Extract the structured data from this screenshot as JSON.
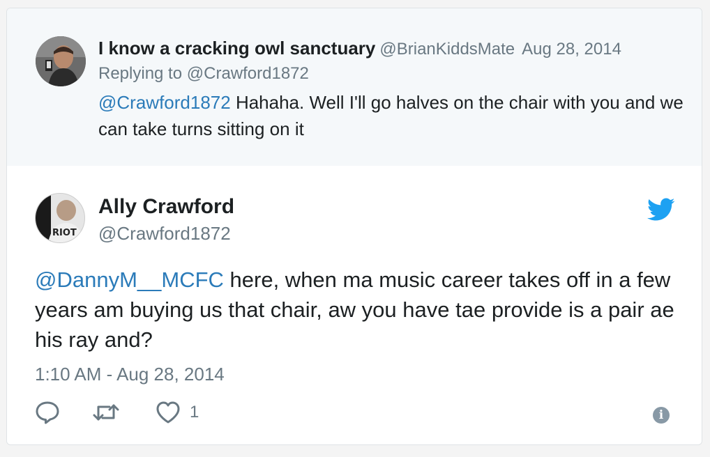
{
  "parent_tweet": {
    "author_name": "I know a cracking owl sanctuary",
    "author_handle": "@BrianKiddsMate",
    "date": "Aug 28, 2014",
    "replying_to_prefix": "Replying to",
    "replying_to_handle": "@Crawford1872",
    "text_mention": "@Crawford1872",
    "text_body": " Hahaha. Well I'll go halves on the chair with you and we can take turns sitting on it"
  },
  "main_tweet": {
    "author_name": "Ally Crawford",
    "author_handle": "@Crawford1872",
    "avatar_text": "RIOT",
    "text_mention": "@DannyM__MCFC",
    "text_body": " here, when ma music career takes off in a few years am buying us that chair, aw you have tae provide is a pair ae his ray and?",
    "timestamp": "1:10 AM - Aug 28, 2014",
    "like_count": "1"
  },
  "icons": {
    "twitter_bird": "twitter-bird-icon",
    "reply": "reply-icon",
    "retweet": "retweet-icon",
    "like": "heart-icon",
    "info": "info-icon"
  },
  "colors": {
    "link": "#2b7bb9",
    "muted": "#697882",
    "twitter_blue": "#1da1f2",
    "parent_background": "#f5f8fa"
  }
}
